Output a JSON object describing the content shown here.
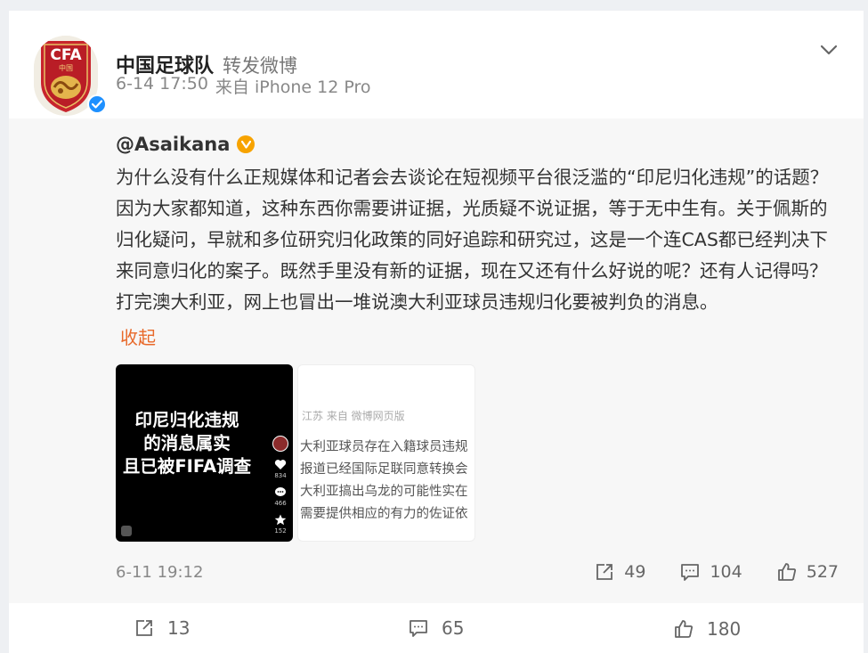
{
  "post": {
    "author": "中国足球队",
    "action": "转发微博",
    "date": "6-14 17:50",
    "source": "来自 iPhone 12 Pro",
    "avatar_text": "CFA",
    "avatar_sub": "中国"
  },
  "repost": {
    "author": "@Asaikana",
    "text": "为什么没有什么正规媒体和记者会去谈论在短视频平台很泛滥的“印尼归化违规”的话题？因为大家都知道，这种东西你需要讲证据，光质疑不说证据，等于无中生有。关于佩斯的归化疑问，早就和多位研究归化政策的同好追踪和研究过，这是一个连CAS都已经判决下来同意归化的案子。既然手里没有新的证据，现在又还有什么好说的呢？还有人记得吗？打完澳大利亚，网上也冒出一堆说澳大利亚球员违规归化要被判负的消息。",
    "collapse_label": "收起",
    "date": "6-11 19:12",
    "reposts": "49",
    "comments": "104",
    "likes": "527",
    "thumb1": {
      "line1": "印尼归化违规",
      "line2": "的消息属实",
      "line3": "且已被FIFA调查",
      "like_count": "834",
      "comment_count": "466",
      "fav_count": "152"
    },
    "thumb2": {
      "header": "江苏 来自 微博网页版",
      "lines": [
        "大利亚球员存在入籍球员违规",
        "报道已经国际足联同意转换会",
        "大利亚搞出乌龙的可能性实在",
        "需要提供相应的有力的佐证依"
      ]
    }
  },
  "footer": {
    "reposts": "13",
    "comments": "65",
    "likes": "180"
  },
  "colors": {
    "accent_orange": "#e8692a",
    "verified_blue": "#1e90ff",
    "gold_badge": "#f7a300",
    "repost_bg": "#f7f7f7",
    "page_bg": "#eef0f3"
  }
}
